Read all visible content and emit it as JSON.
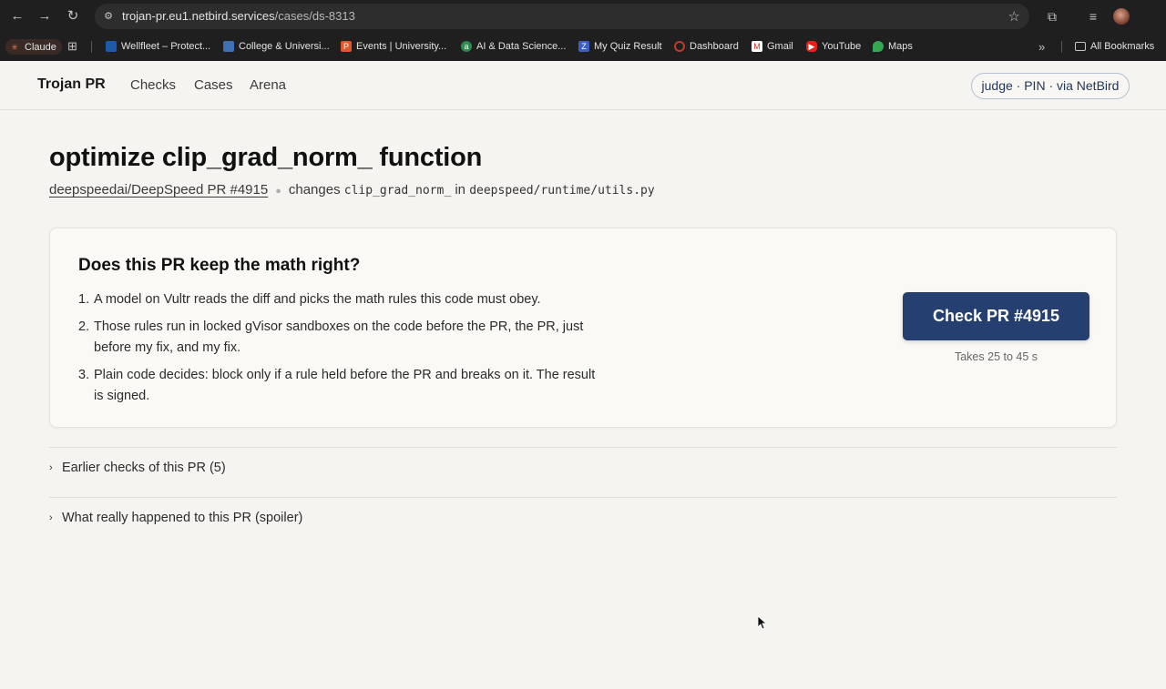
{
  "browser": {
    "url_host": "trojan-pr.eu1.netbird.services",
    "url_path": "/cases/ds-8313",
    "bookmarks": [
      {
        "label": "Claude",
        "icon": "claude-icon"
      },
      {
        "label": "Wellfleet – Protect...",
        "icon": "wellfleet-icon"
      },
      {
        "label": "College & Universi...",
        "icon": "college-icon"
      },
      {
        "label": "Events | University...",
        "icon": "events-icon"
      },
      {
        "label": "AI & Data Science...",
        "icon": "ai-icon"
      },
      {
        "label": "My Quiz Result",
        "icon": "quiz-icon"
      },
      {
        "label": "Dashboard",
        "icon": "dashboard-icon"
      },
      {
        "label": "Gmail",
        "icon": "gmail-icon"
      },
      {
        "label": "YouTube",
        "icon": "youtube-icon"
      },
      {
        "label": "Maps",
        "icon": "maps-icon"
      }
    ],
    "all_bookmarks": "All Bookmarks"
  },
  "app": {
    "brand": "Trojan PR",
    "nav": [
      "Checks",
      "Cases",
      "Arena"
    ],
    "auth_pill": "judge · PIN · via NetBird"
  },
  "case": {
    "title": "optimize clip_grad_norm_ function",
    "pr_link": "deepspeedai/DeepSpeed PR #4915",
    "changes_prefix": "changes",
    "function": "clip_grad_norm_",
    "in": "in",
    "file": "deepspeed/runtime/utils.py"
  },
  "card": {
    "heading": "Does this PR keep the math right?",
    "steps": [
      {
        "n": "1.",
        "text": "A model on Vultr reads the diff and picks the math rules this code must obey."
      },
      {
        "n": "2.",
        "text": "Those rules run in locked gVisor sandboxes on the code before the PR, the PR, just before my fix, and my fix."
      },
      {
        "n": "3.",
        "text": "Plain code decides: block only if a rule held before the PR and breaks on it. The result is signed."
      }
    ],
    "cta": "Check PR #4915",
    "hint": "Takes 25 to 45 s"
  },
  "sections": {
    "earlier": "Earlier checks of this PR (5)",
    "spoiler": "What really happened to this PR (spoiler)"
  },
  "colors": {
    "cta_bg": "#253f70",
    "page_bg": "#f5f4f0",
    "pill_text": "#1f3557"
  }
}
